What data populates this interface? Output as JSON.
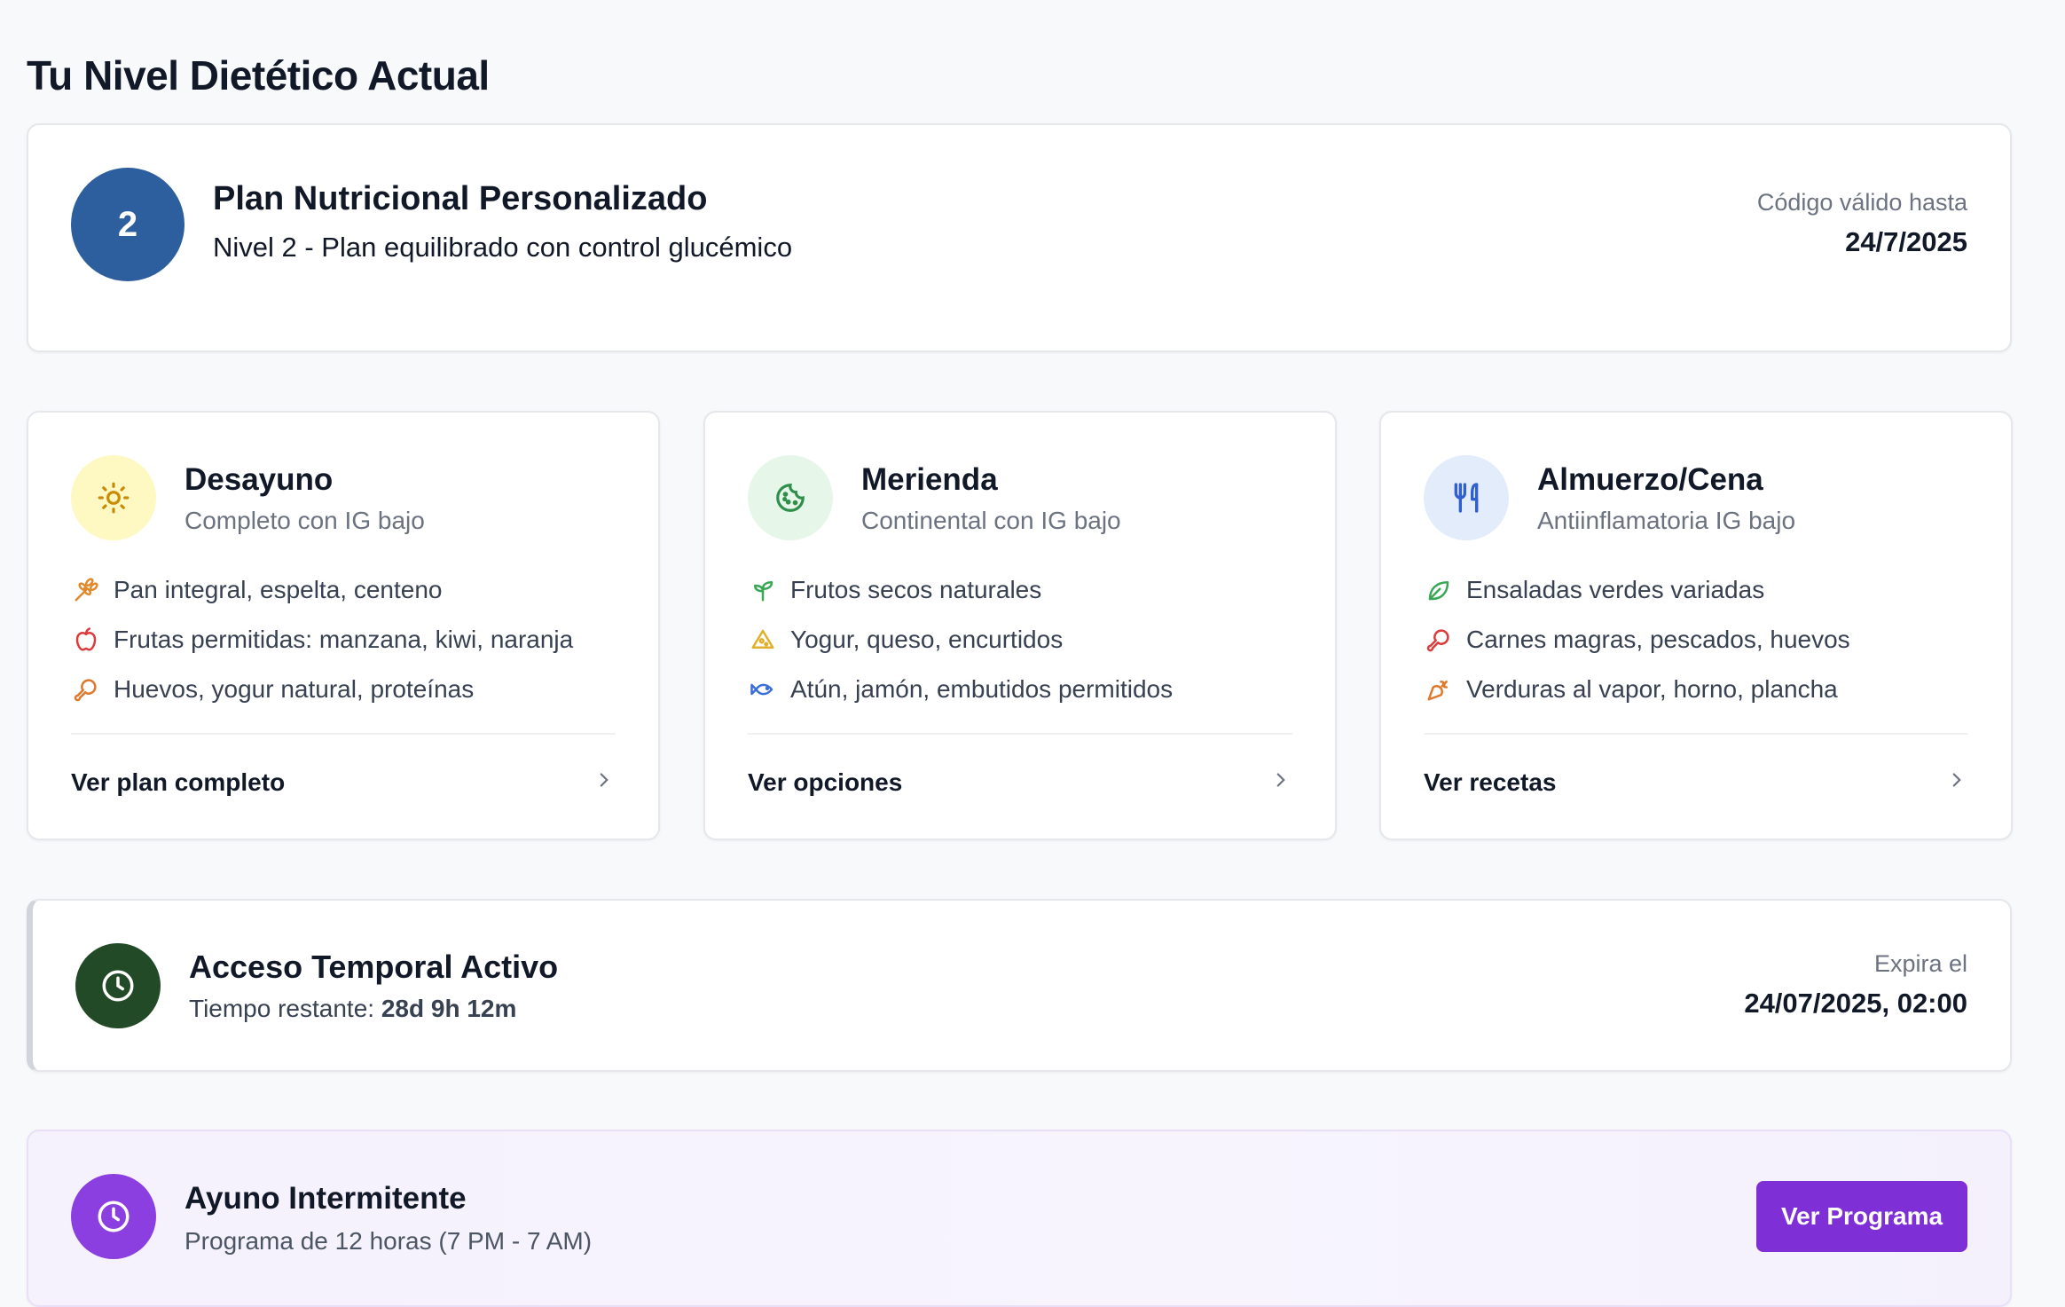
{
  "page": {
    "title": "Tu Nivel Dietético Actual"
  },
  "plan": {
    "level": "2",
    "title": "Plan Nutricional Personalizado",
    "subtitle": "Nivel 2 - Plan equilibrado con control glucémico",
    "valid_label": "Código válido hasta",
    "valid_date": "24/7/2025"
  },
  "meals": [
    {
      "title": "Desayuno",
      "subtitle": "Completo con IG bajo",
      "icon": "sun-icon",
      "icon_bg": "#fef9c3",
      "items": [
        {
          "text": "Pan integral, espelta, centeno",
          "icon": "wheat-icon",
          "color": "#e08a2c"
        },
        {
          "text": "Frutas permitidas: manzana, kiwi, naranja",
          "icon": "apple-icon",
          "color": "#dc3b3b"
        },
        {
          "text": "Huevos, yogur natural, proteínas",
          "icon": "drumstick-icon",
          "color": "#e0782c"
        }
      ],
      "link": "Ver plan completo"
    },
    {
      "title": "Merienda",
      "subtitle": "Continental con IG bajo",
      "icon": "cookie-icon",
      "icon_bg": "#e6f7ea",
      "items": [
        {
          "text": "Frutos secos naturales",
          "icon": "sprout-icon",
          "color": "#3aa757"
        },
        {
          "text": "Yogur, queso, encurtidos",
          "icon": "cheese-icon",
          "color": "#e0b02c"
        },
        {
          "text": "Atún, jamón, embutidos permitidos",
          "icon": "fish-icon",
          "color": "#3b6fd8"
        }
      ],
      "link": "Ver opciones"
    },
    {
      "title": "Almuerzo/Cena",
      "subtitle": "Antiinflamatoria IG bajo",
      "icon": "utensils-icon",
      "icon_bg": "#e3ecfb",
      "items": [
        {
          "text": "Ensaladas verdes variadas",
          "icon": "leaf-icon",
          "color": "#3aa757"
        },
        {
          "text": "Carnes magras, pescados, huevos",
          "icon": "drumstick-icon",
          "color": "#dc3b3b"
        },
        {
          "text": "Verduras al vapor, horno, plancha",
          "icon": "carrot-icon",
          "color": "#e0782c"
        }
      ],
      "link": "Ver recetas"
    }
  ],
  "access": {
    "title": "Acceso Temporal Activo",
    "remaining_label": "Tiempo restante: ",
    "remaining_value": "28d 9h 12m",
    "expira_label": "Expira el",
    "expira_date": "24/07/2025, 02:00"
  },
  "fasting": {
    "title": "Ayuno Intermitente",
    "subtitle": "Programa de 12 horas (7 PM - 7 AM)",
    "button": "Ver Programa"
  }
}
